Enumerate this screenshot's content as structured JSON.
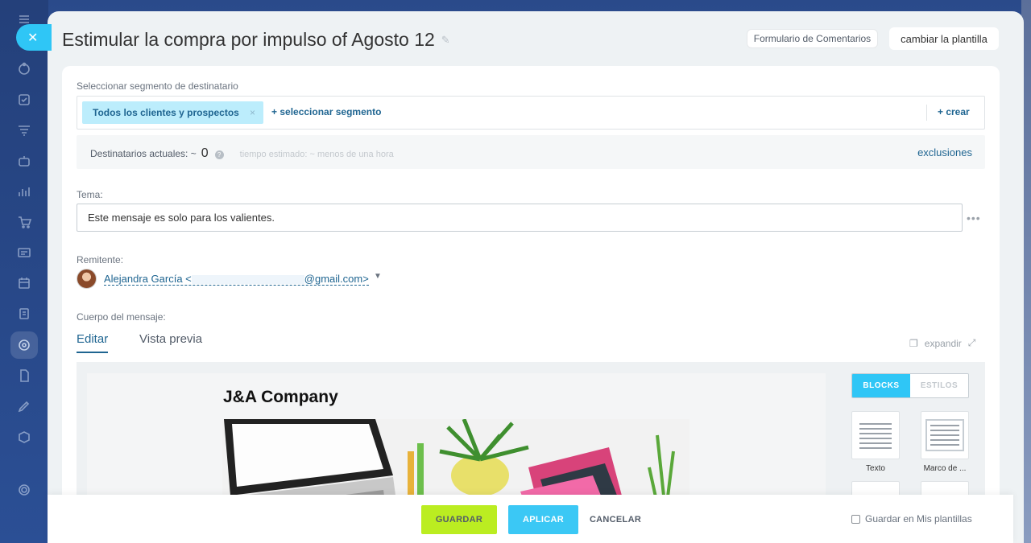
{
  "panel": {
    "title": "Estimular la compra por impulso of Agosto 12",
    "feedback_button": "Formulario de Comentarios",
    "template_button": "cambiar la plantilla"
  },
  "segment": {
    "label": "Seleccionar segmento de destinatario",
    "chip": "Todos los clientes y prospectos",
    "chip_remove": "×",
    "add": "+ seleccionar segmento",
    "create": "+ crear"
  },
  "recipients": {
    "label": "Destinatarios actuales: ~",
    "count": "0",
    "estimate": "tiempo estimado: ~ menos de una hora",
    "exclusions": "exclusiones"
  },
  "subject": {
    "label": "Tema:",
    "value": "Este mensaje es solo para los valientes."
  },
  "sender": {
    "label": "Remitente:",
    "name": "Alejandra García <",
    "email_domain": "@gmail.com>"
  },
  "body": {
    "label": "Cuerpo del mensaje:",
    "tab_edit": "Editar",
    "tab_preview": "Vista previa",
    "expand": "expandir",
    "company": "J&A Company"
  },
  "blocks_panel": {
    "tab_blocks": "BLOCKS",
    "tab_styles": "ESTILOS",
    "items": [
      {
        "label": "Texto"
      },
      {
        "label": "Marco de ..."
      }
    ]
  },
  "footer": {
    "save": "GUARDAR",
    "apply": "APLICAR",
    "cancel": "CANCELAR",
    "save_template": "Guardar en Mis plantillas"
  },
  "colors": {
    "accent": "#2fc6f6",
    "link": "#1f6591",
    "save": "#bbed21",
    "apply": "#3bc8f5"
  }
}
